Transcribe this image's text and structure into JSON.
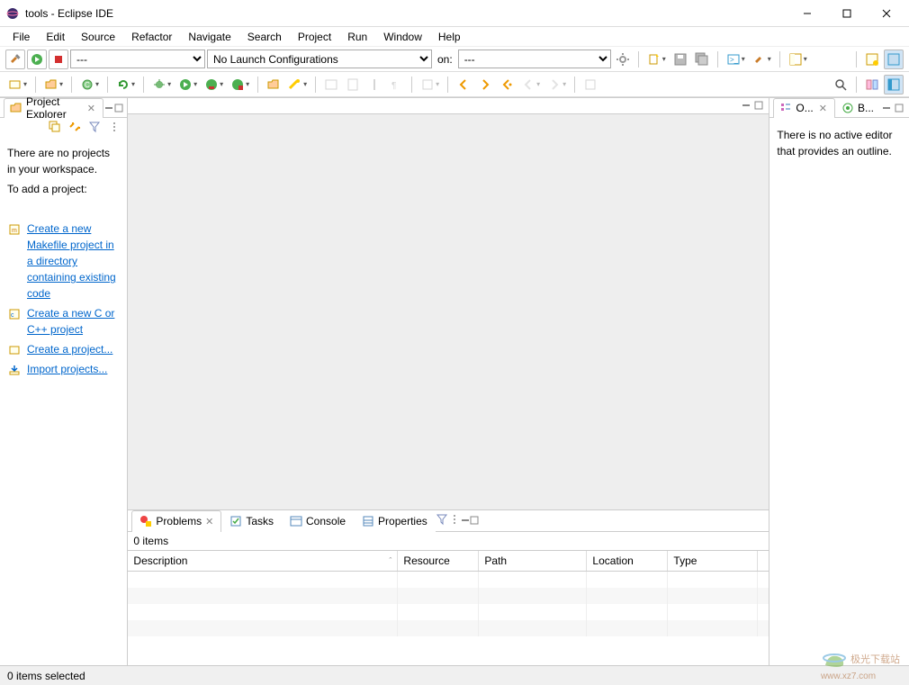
{
  "titlebar": {
    "title": "tools - Eclipse IDE"
  },
  "menubar": {
    "items": [
      "File",
      "Edit",
      "Source",
      "Refactor",
      "Navigate",
      "Search",
      "Project",
      "Run",
      "Window",
      "Help"
    ]
  },
  "toolbar1": {
    "run_selector": "---",
    "launch_config": "No Launch Configurations",
    "on_label": "on:",
    "target_selector": "---"
  },
  "project_explorer": {
    "title": "Project Explorer",
    "msg_line1": "There are no projects in your workspace.",
    "msg_line2": "To add a project:",
    "links": {
      "makefile": "Create a new Makefile project in a directory containing existing code",
      "cpp": "Create a new C or C++ project",
      "project": "Create a project...",
      "import": "Import projects..."
    }
  },
  "outline": {
    "tab1": "O...",
    "tab2": "B...",
    "msg": "There is no active editor that provides an outline."
  },
  "bottom": {
    "tabs": {
      "problems": "Problems",
      "tasks": "Tasks",
      "console": "Console",
      "properties": "Properties"
    },
    "summary": "0 items",
    "columns": {
      "description": "Description",
      "resource": "Resource",
      "path": "Path",
      "location": "Location",
      "type": "Type"
    }
  },
  "statusbar": {
    "text": "0 items selected"
  },
  "watermark": {
    "brand": "极光下载站",
    "url": "www.xz7.com"
  }
}
